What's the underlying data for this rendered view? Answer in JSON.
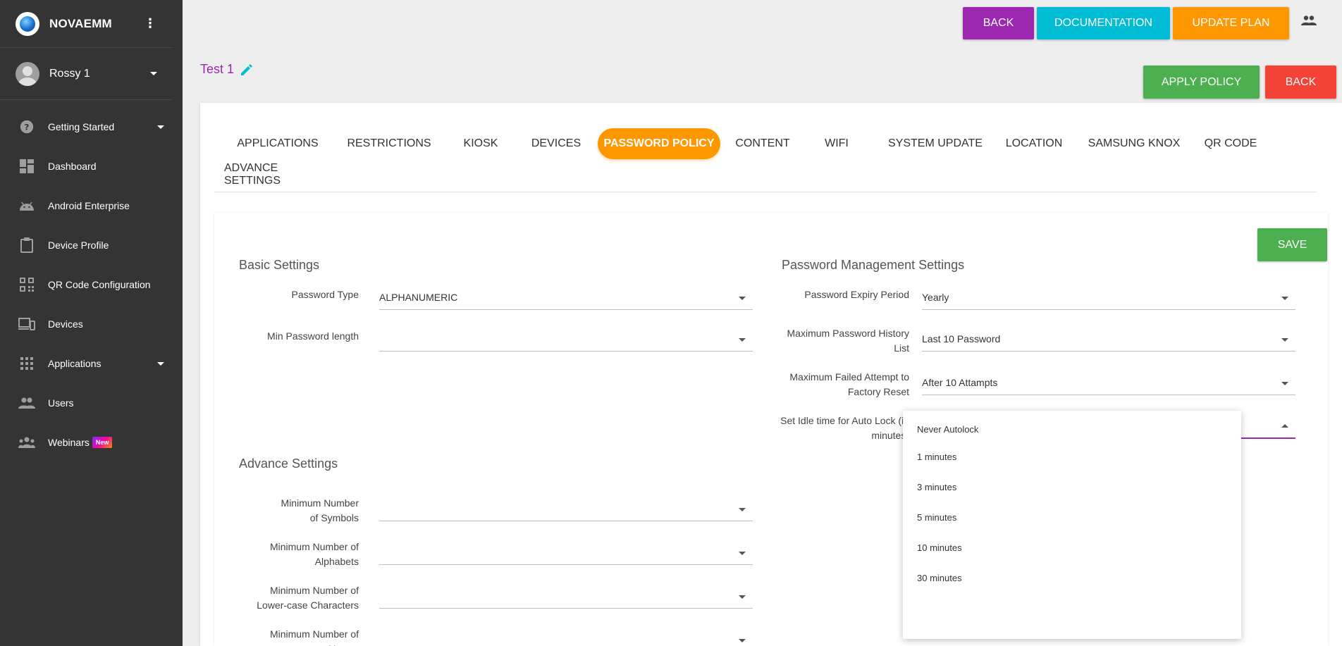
{
  "sidebar": {
    "brand": "NOVAEMM",
    "user": "Rossy 1",
    "items": [
      {
        "label": "Getting Started",
        "icon": "help-circle-icon",
        "expandable": true
      },
      {
        "label": "Dashboard",
        "icon": "dashboard-icon",
        "expandable": false
      },
      {
        "label": "Android Enterprise",
        "icon": "android-icon",
        "expandable": false
      },
      {
        "label": "Device Profile",
        "icon": "clipboard-icon",
        "expandable": false
      },
      {
        "label": "QR Code Configuration",
        "icon": "qr-code-icon",
        "expandable": false
      },
      {
        "label": "Devices",
        "icon": "devices-icon",
        "expandable": false
      },
      {
        "label": "Applications",
        "icon": "apps-grid-icon",
        "expandable": true
      },
      {
        "label": "Users",
        "icon": "users-icon",
        "expandable": false
      },
      {
        "label": "Webinars",
        "icon": "groups-icon",
        "expandable": false,
        "badge": "New"
      }
    ]
  },
  "topbar": {
    "back": "BACK",
    "documentation": "DOCUMENTATION",
    "update_plan": "UPDATE PLAN"
  },
  "policy": {
    "title": "Test 1",
    "apply": "APPLY POLICY",
    "back": "BACK"
  },
  "tabs": [
    {
      "label": "APPLICATIONS",
      "active": false
    },
    {
      "label": "RESTRICTIONS",
      "active": false
    },
    {
      "label": "KIOSK",
      "active": false
    },
    {
      "label": "DEVICES",
      "active": false
    },
    {
      "label": "PASSWORD POLICY",
      "active": true
    },
    {
      "label": "CONTENT",
      "active": false
    },
    {
      "label": "WIFI",
      "active": false
    },
    {
      "label": "SYSTEM UPDATE",
      "active": false
    },
    {
      "label": "LOCATION",
      "active": false
    },
    {
      "label": "SAMSUNG KNOX",
      "active": false
    },
    {
      "label": "QR CODE",
      "active": false
    },
    {
      "label": "ADVANCE SETTINGS",
      "active": false
    }
  ],
  "form": {
    "save": "SAVE",
    "basic_title": "Basic Settings",
    "mgmt_title": "Password Management Settings",
    "advance_title": "Advance Settings",
    "basic": [
      {
        "label": "Password Type",
        "value": "ALPHANUMERIC"
      },
      {
        "label": "Min Password length",
        "value": ""
      }
    ],
    "mgmt": [
      {
        "label": "Password Expiry Period",
        "value": "Yearly"
      },
      {
        "label": "Maximum Password History List",
        "value": "Last 10 Password"
      },
      {
        "label": "Maximum Failed Attempt to Factory Reset",
        "value": "After 10 Attampts"
      },
      {
        "label": "Set Idle time for Auto Lock (in minutes)",
        "value": ""
      }
    ],
    "advance": [
      {
        "label": "Minimum Number of Symbols",
        "value": ""
      },
      {
        "label": "Minimum Number of Alphabets",
        "value": ""
      },
      {
        "label": "Minimum Number of Lower-case Characters",
        "value": ""
      },
      {
        "label": "Minimum Number of Upper-",
        "value": ""
      }
    ]
  },
  "dropdown": {
    "options": [
      "Never Autolock",
      "1 minutes",
      "3 minutes",
      "5 minutes",
      "10 minutes",
      "30 minutes"
    ]
  },
  "colors": {
    "sidebar": "#343434",
    "accent_purple": "#9c27b0",
    "accent_cyan": "#00bcd4",
    "accent_orange": "#ff9800",
    "green": "#4caf50",
    "red": "#f44336"
  }
}
